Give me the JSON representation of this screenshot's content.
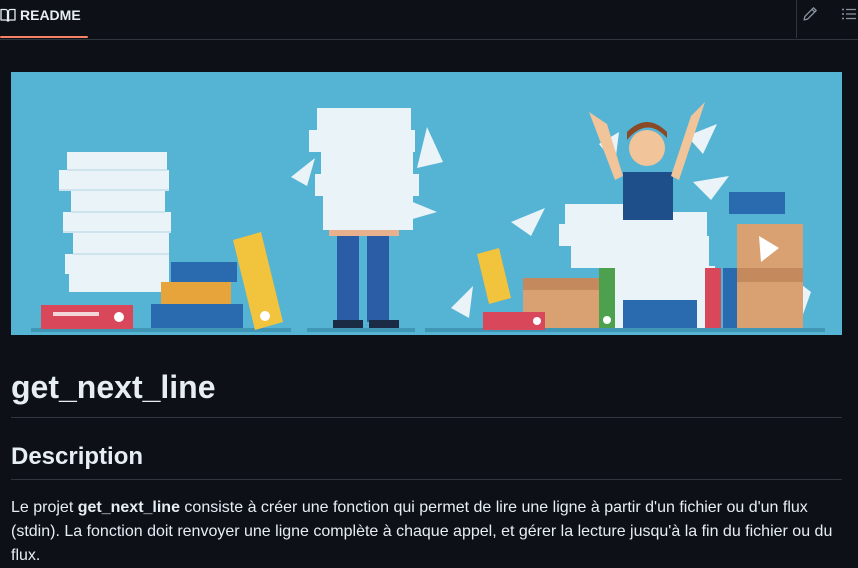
{
  "readme": {
    "tab_label": "README",
    "tab_icon": "book-icon",
    "edit_icon": "pencil-icon",
    "outline_icon": "list-icon"
  },
  "banner": {
    "description": "",
    "colors": {
      "sky": "#55b3d3",
      "accent": "#f78166"
    }
  },
  "doc": {
    "title": "get_next_line",
    "section": "Description",
    "para_prefix": "Le projet ",
    "para_bold": "get_next_line",
    "para_suffix": " consiste à créer une fonction qui permet de lire une ligne à partir d'un fichier ou d'un flux (stdin). La fonction doit renvoyer une ligne complète à chaque appel, et gérer la lecture jusqu'à la fin du fichier ou du flux."
  }
}
